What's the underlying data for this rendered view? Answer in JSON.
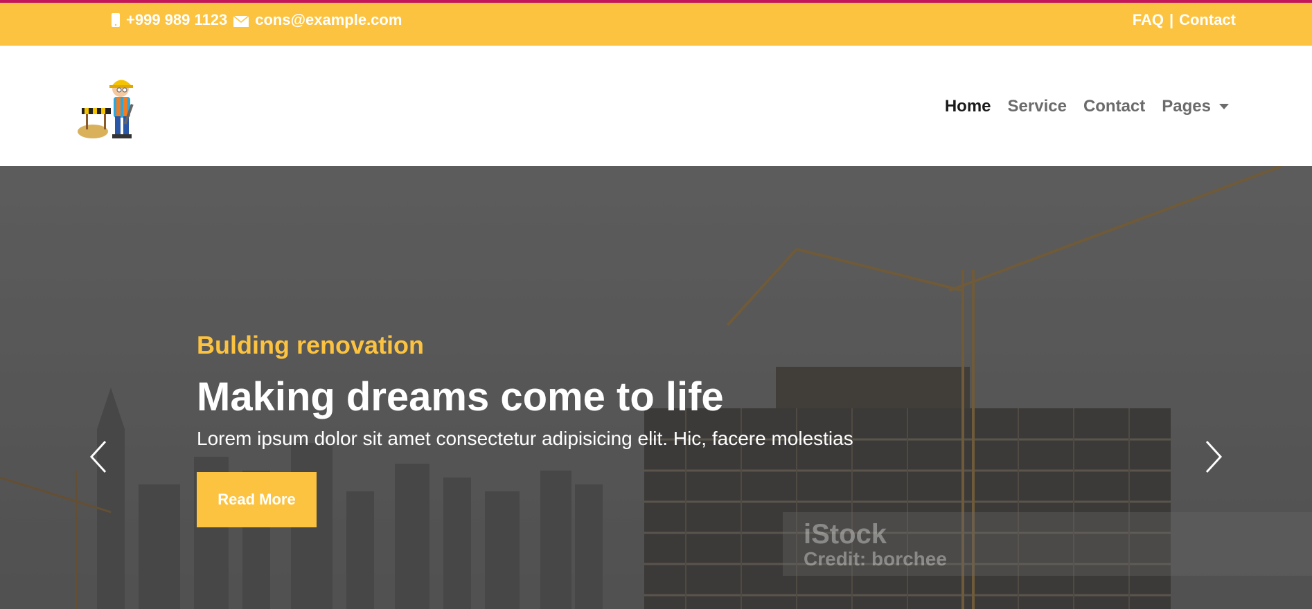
{
  "topbar": {
    "phone": "+999 989 1123",
    "email": "cons@example.com",
    "faq_label": "FAQ",
    "separator": "|",
    "contact_label": "Contact",
    "phone_icon": "phone-icon",
    "mail_icon": "mail-icon"
  },
  "navbar": {
    "logo_icon": "construction-worker-logo",
    "items": [
      {
        "label": "Home",
        "active": true
      },
      {
        "label": "Service",
        "active": false
      },
      {
        "label": "Contact",
        "active": false
      },
      {
        "label": "Pages",
        "active": false,
        "dropdown": true
      }
    ]
  },
  "hero": {
    "subtitle": "Bulding renovation",
    "title": "Making dreams come to life",
    "text": "Lorem ipsum dolor sit amet consectetur adipisicing elit. Hic, facere molestias",
    "button_label": "Read More",
    "watermark_brand": "iStock",
    "watermark_credit": "Credit: borchee"
  },
  "colors": {
    "accent": "#fcc340",
    "top_border": "#c2185b",
    "nav_active": "#1a1a1a",
    "nav_inactive": "#6b6b6b"
  }
}
